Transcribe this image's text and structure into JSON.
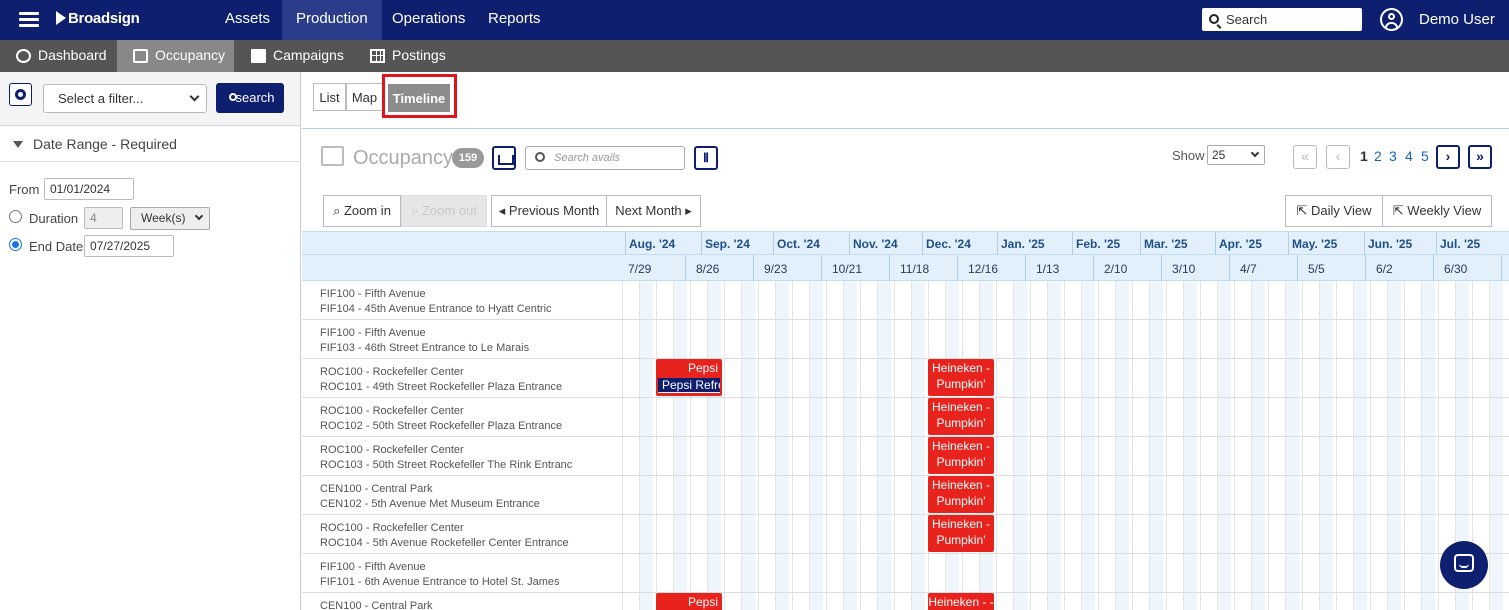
{
  "topnav": {
    "brand": "Broadsign",
    "items": [
      "Assets",
      "Production",
      "Operations",
      "Reports"
    ],
    "active": "Production",
    "search_placeholder": "Search",
    "user": "Demo User"
  },
  "subnav": {
    "items": [
      "Dashboard",
      "Occupancy",
      "Campaigns",
      "Postings"
    ],
    "active": "Occupancy"
  },
  "filters": {
    "select_placeholder": "Select a filter...",
    "search_label": "search",
    "date_range_title": "Date Range - Required",
    "from_label": "From",
    "from_value": "01/01/2024",
    "duration_label": "Duration",
    "duration_value": "4",
    "duration_unit": "Week(s)",
    "end_date_label": "End Date",
    "end_date_value": "07/27/2025",
    "end_date_selected": true
  },
  "view_tabs": {
    "list": "List",
    "map": "Map",
    "timeline": "Timeline",
    "active": "Timeline"
  },
  "occupancy": {
    "title": "Occupancy",
    "count": "159",
    "search_placeholder": "Search avails",
    "columns_icon": "columns-icon",
    "show_label": "Show",
    "show_value": "25",
    "pages": [
      "1",
      "2",
      "3",
      "4",
      "5"
    ],
    "current_page": "1"
  },
  "toolbar": {
    "zoom_in": "Zoom in",
    "zoom_out": "Zoom out",
    "previous_month": "Previous Month",
    "next_month": "Next Month",
    "daily_view": "Daily View",
    "weekly_view": "Weekly View"
  },
  "timeline": {
    "months": [
      "Aug. '24",
      "Sep. '24",
      "Oct. '24",
      "Nov. '24",
      "Dec. '24",
      "Jan. '25",
      "Feb. '25",
      "Mar. '25",
      "Apr. '25",
      "May. '25",
      "Jun. '25",
      "Jul. '25"
    ],
    "weeks": [
      "7/29",
      "8/26",
      "9/23",
      "10/21",
      "11/18",
      "12/16",
      "1/13",
      "2/10",
      "3/10",
      "4/7",
      "5/5",
      "6/2",
      "6/30"
    ],
    "rows": [
      {
        "line1": "FIF100 - Fifth Avenue",
        "line2": "FIF104 - 45th Avenue Entrance to Hyatt Centric",
        "bars": []
      },
      {
        "line1": "FIF100 - Fifth Avenue",
        "line2": "FIF103 - 46th Street Entrance to Le Marais",
        "bars": []
      },
      {
        "line1": "ROC100 - Rockefeller Center",
        "line2": "ROC101 - 49th Street Rockefeller Plaza Entrance",
        "bars": [
          {
            "label": "Pepsi",
            "sub": "Pepsi Refres",
            "start": "8/12/2024",
            "end": "9/8/2024"
          },
          {
            "label": "Heineken - Pumpkin'",
            "start": "12/2/2024",
            "end": "12/29/2024"
          }
        ]
      },
      {
        "line1": "ROC100 - Rockefeller Center",
        "line2": "ROC102 - 50th Street Rockefeller Plaza Entrance",
        "bars": [
          {
            "label": "Heineken - Pumpkin'",
            "start": "12/2/2024",
            "end": "12/29/2024"
          }
        ]
      },
      {
        "line1": "ROC100 - Rockefeller Center",
        "line2": "ROC103 - 50th Street Rockefeller The Rink Entranc",
        "bars": [
          {
            "label": "Heineken - Pumpkin'",
            "start": "12/2/2024",
            "end": "12/29/2024"
          }
        ]
      },
      {
        "line1": "CEN100 - Central Park",
        "line2": "CEN102 - 5th Avenue Met Museum Entrance",
        "bars": [
          {
            "label": "Heineken - Pumpkin'",
            "start": "12/2/2024",
            "end": "12/29/2024"
          }
        ]
      },
      {
        "line1": "ROC100 - Rockefeller Center",
        "line2": "ROC104 - 5th Avenue Rockefeller Center Entrance",
        "bars": [
          {
            "label": "Heineken - Pumpkin'",
            "start": "12/2/2024",
            "end": "12/29/2024"
          }
        ]
      },
      {
        "line1": "FIF100 - Fifth Avenue",
        "line2": "FIF101 - 6th Avenue Entrance to Hotel St. James",
        "bars": []
      },
      {
        "line1": "CEN100 - Central Park",
        "line2": "",
        "bars": [
          {
            "label": "Pepsi",
            "start": "8/12/2024",
            "end": "9/8/2024"
          },
          {
            "label": "Heineken -",
            "start": "12/2/2024",
            "end": "12/29/2024"
          }
        ]
      }
    ]
  },
  "colors": {
    "nav": "#0d1f6e",
    "booking": "#e8231d",
    "highlight": "#e0141a"
  }
}
